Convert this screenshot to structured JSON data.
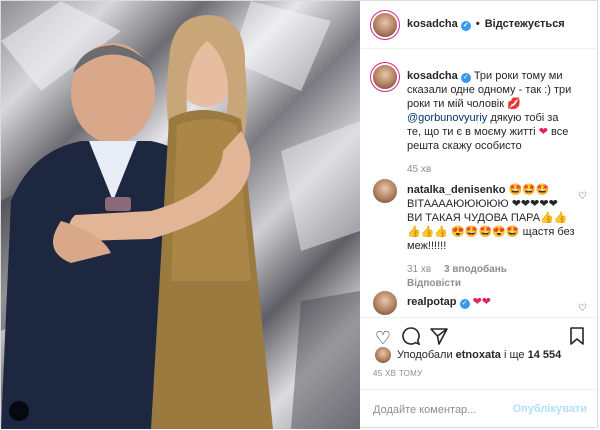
{
  "header": {
    "username": "kosadcha",
    "separator": "•",
    "follow_label": "Відстежується"
  },
  "caption": {
    "username": "kosadcha",
    "text_1": "Три роки тому ми сказали одне одному - так :) три роки ти мій чоловік",
    "mention": "@gorbunovyuriy",
    "text_2": "дякую тобі за те, що ти є в моєму житті",
    "text_3": "все решта скажу особисто",
    "time": "45 хв"
  },
  "comment_1": {
    "username": "natalka_denisenko",
    "text": "🤩🤩🤩 ВІТААААЮЮЮЮЮ ❤❤❤❤❤ ВИ ТАКАЯ ЧУДОВА ПАРА👍👍👍👍👍 😍🤩🤩😍🤩 щастя без меж!!!!!!",
    "time": "31 хв",
    "likes": "3 вподобань",
    "reply": "Відповісти"
  },
  "comment_2": {
    "username": "realpotap",
    "text": "❤❤"
  },
  "actions": {
    "like_icon": "heart-icon",
    "comment_icon": "comment-icon",
    "share_icon": "share-icon",
    "save_icon": "bookmark-icon"
  },
  "likes": {
    "prefix": "Уподобали",
    "user": "etnoxata",
    "middle": "і ще",
    "count": "14 554"
  },
  "timestamp": "45 ХВ ТОМУ",
  "add_comment": {
    "placeholder": "Додайте коментар...",
    "publish_label": "Опублікувати"
  },
  "colors": {
    "verified": "#3897f0",
    "heart": "#e0245e",
    "link": "#00376b",
    "publish_disabled": "#b2dffc"
  }
}
